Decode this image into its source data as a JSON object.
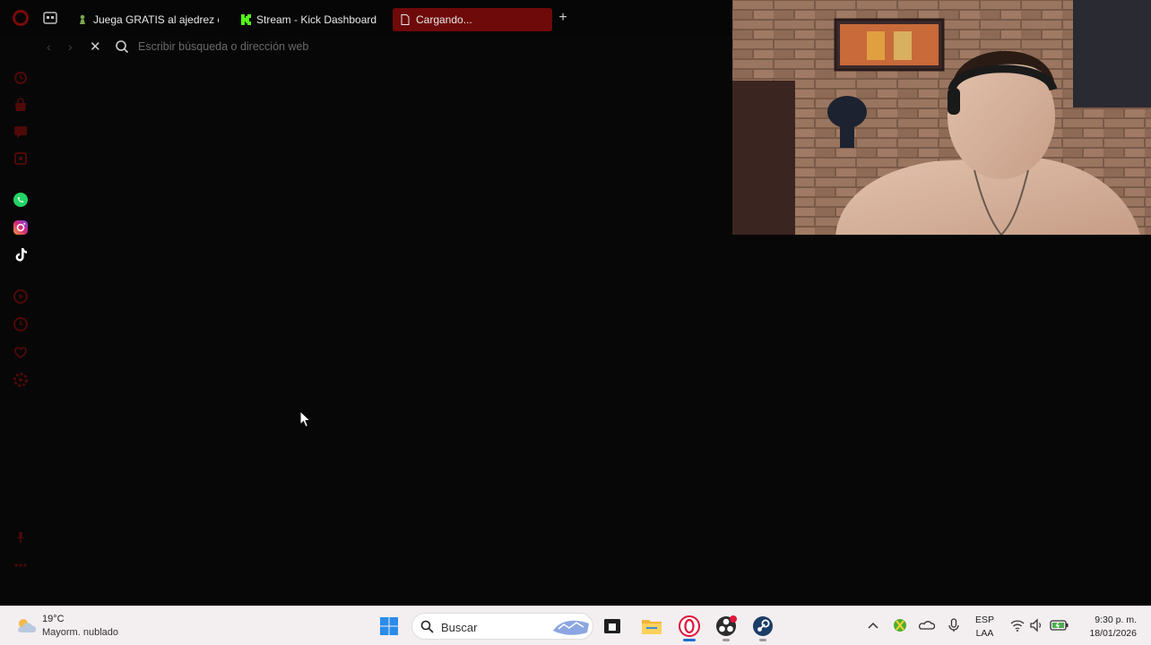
{
  "browser": {
    "tabs": [
      {
        "label": "Juega GRATIS al ajedrez o",
        "favicon": "chess-pawn-icon",
        "active": false
      },
      {
        "label": "Stream - Kick Dashboard",
        "favicon": "kick-logo-icon",
        "active": false
      },
      {
        "label": "Cargando...",
        "favicon": "page-icon",
        "active": true
      }
    ],
    "address_placeholder": "Escribir búsqueda o dirección web",
    "accent_color": "#6e0a0a"
  },
  "sidebar": {
    "items": [
      "history-icon",
      "shop-icon",
      "messenger-icon",
      "extension-icon",
      "whatsapp-icon",
      "instagram-icon",
      "tiktok-icon",
      "player-icon",
      "clock-icon",
      "bookmark-icon",
      "settings-icon",
      "pin-icon",
      "more-icon"
    ]
  },
  "taskbar": {
    "weather": {
      "temp": "19°C",
      "desc": "Mayorm. nublado"
    },
    "search_label": "Buscar",
    "apps": [
      "windows-start-icon",
      "search-icon",
      "terminal-icon",
      "file-explorer-icon",
      "opera-gx-icon",
      "obs-icon",
      "steam-icon"
    ],
    "tray": [
      "chevron-up-icon",
      "xbox-icon",
      "onedrive-icon",
      "microphone-icon"
    ],
    "language": {
      "line1": "ESP",
      "line2": "LAA"
    },
    "clock": {
      "time": "9:30 p. m.",
      "date": "18/01/2026"
    }
  }
}
